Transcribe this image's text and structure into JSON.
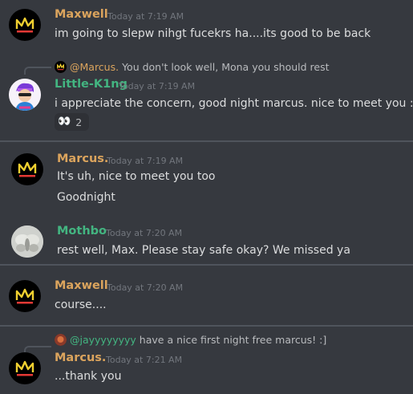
{
  "colors": {
    "background": "#36393f",
    "orange_user": "#dba45d",
    "green_user": "#43b581",
    "mention": "#8e9297",
    "divider": "#4f545c"
  },
  "messages": [
    {
      "author": "Maxwell",
      "time": "Today at 7:19 AM",
      "lines": [
        "im going to slepw nihgt fucekrs ha....its good to be back"
      ]
    },
    {
      "reply": {
        "author": "@Marcus.",
        "text": "You don't look well, Mona you should rest"
      },
      "author": "Little-K1ng",
      "time": "Today at 7:19 AM",
      "lines": [
        "i appreciate the concern, good night marcus. nice to meet you :)"
      ],
      "reaction": {
        "emoji": "eyes-icon",
        "glyph": "👀",
        "count": "2"
      }
    },
    {
      "author": "Marcus.",
      "time": "Today at 7:19 AM",
      "lines": [
        "It's uh, nice to meet you too",
        "Goodnight"
      ]
    },
    {
      "author": "Mothbo",
      "time": "Today at 7:20 AM",
      "lines": [
        "rest well, Max. Please stay safe okay? We missed ya"
      ]
    },
    {
      "author": "Maxwell",
      "time": "Today at 7:20 AM",
      "lines": [
        "course...."
      ]
    },
    {
      "reply": {
        "author": "@jayyyyyyyy",
        "text": "have a nice first night free marcus! :]"
      },
      "author": "Marcus.",
      "time": "Today at 7:21 AM",
      "lines": [
        "...thank you"
      ]
    }
  ]
}
